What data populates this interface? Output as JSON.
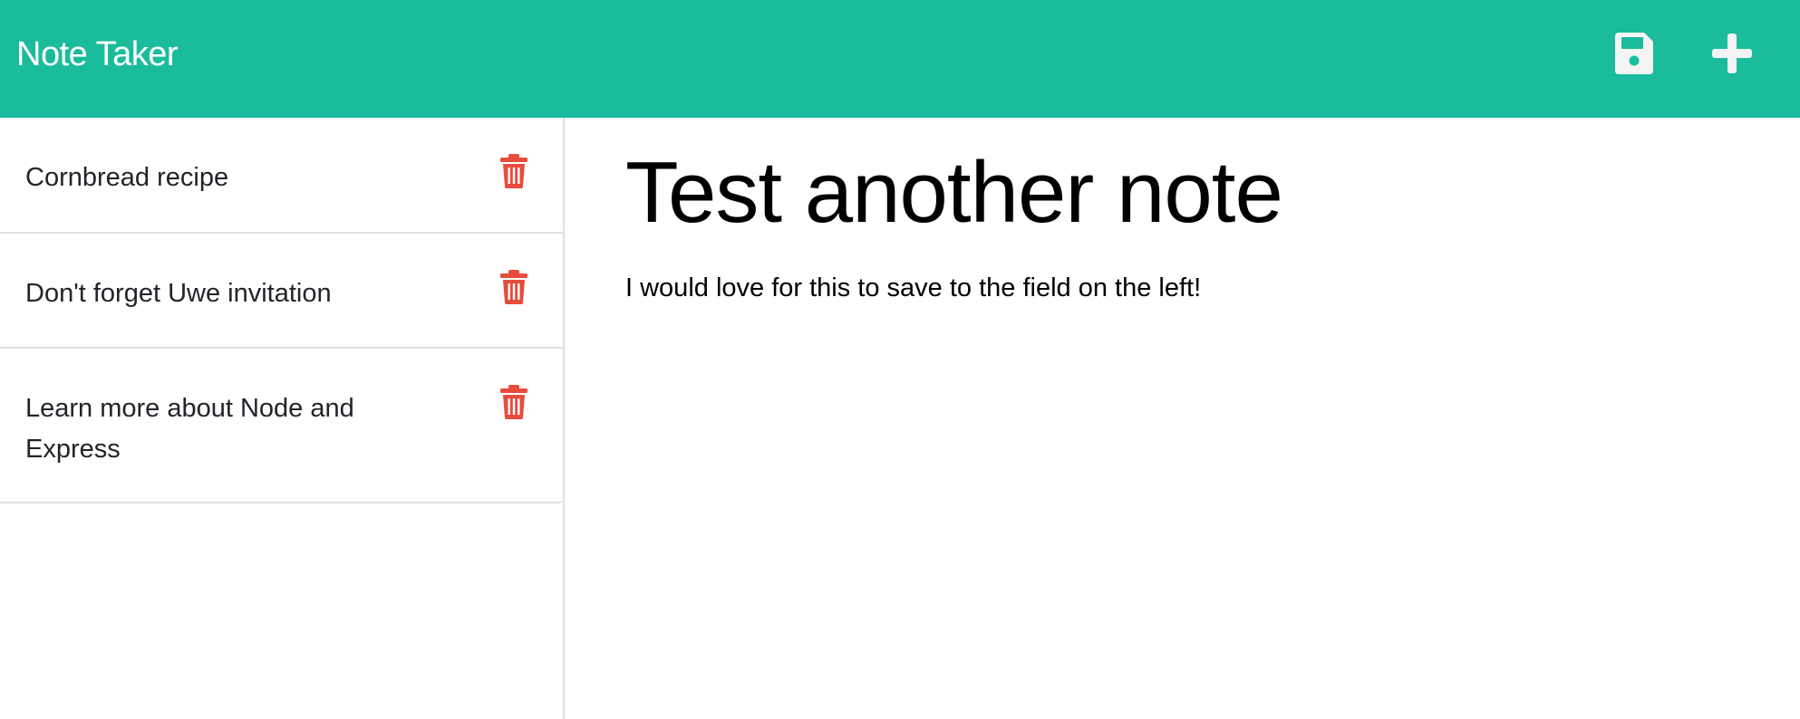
{
  "navbar": {
    "brand": "Note Taker",
    "save_icon": "save-icon",
    "add_icon": "plus-icon",
    "background": "#1abc9c"
  },
  "sidebar": {
    "notes": [
      {
        "title": "Cornbread recipe",
        "icon": "trash-icon"
      },
      {
        "title": "Don't forget Uwe invitation",
        "icon": "trash-icon"
      },
      {
        "title": "Learn more about Node and Express",
        "icon": "trash-icon"
      }
    ],
    "delete_color": "#e74c3c"
  },
  "main": {
    "note_title": "Test another note",
    "note_text": "I would love for this to save to the field on the left!"
  }
}
